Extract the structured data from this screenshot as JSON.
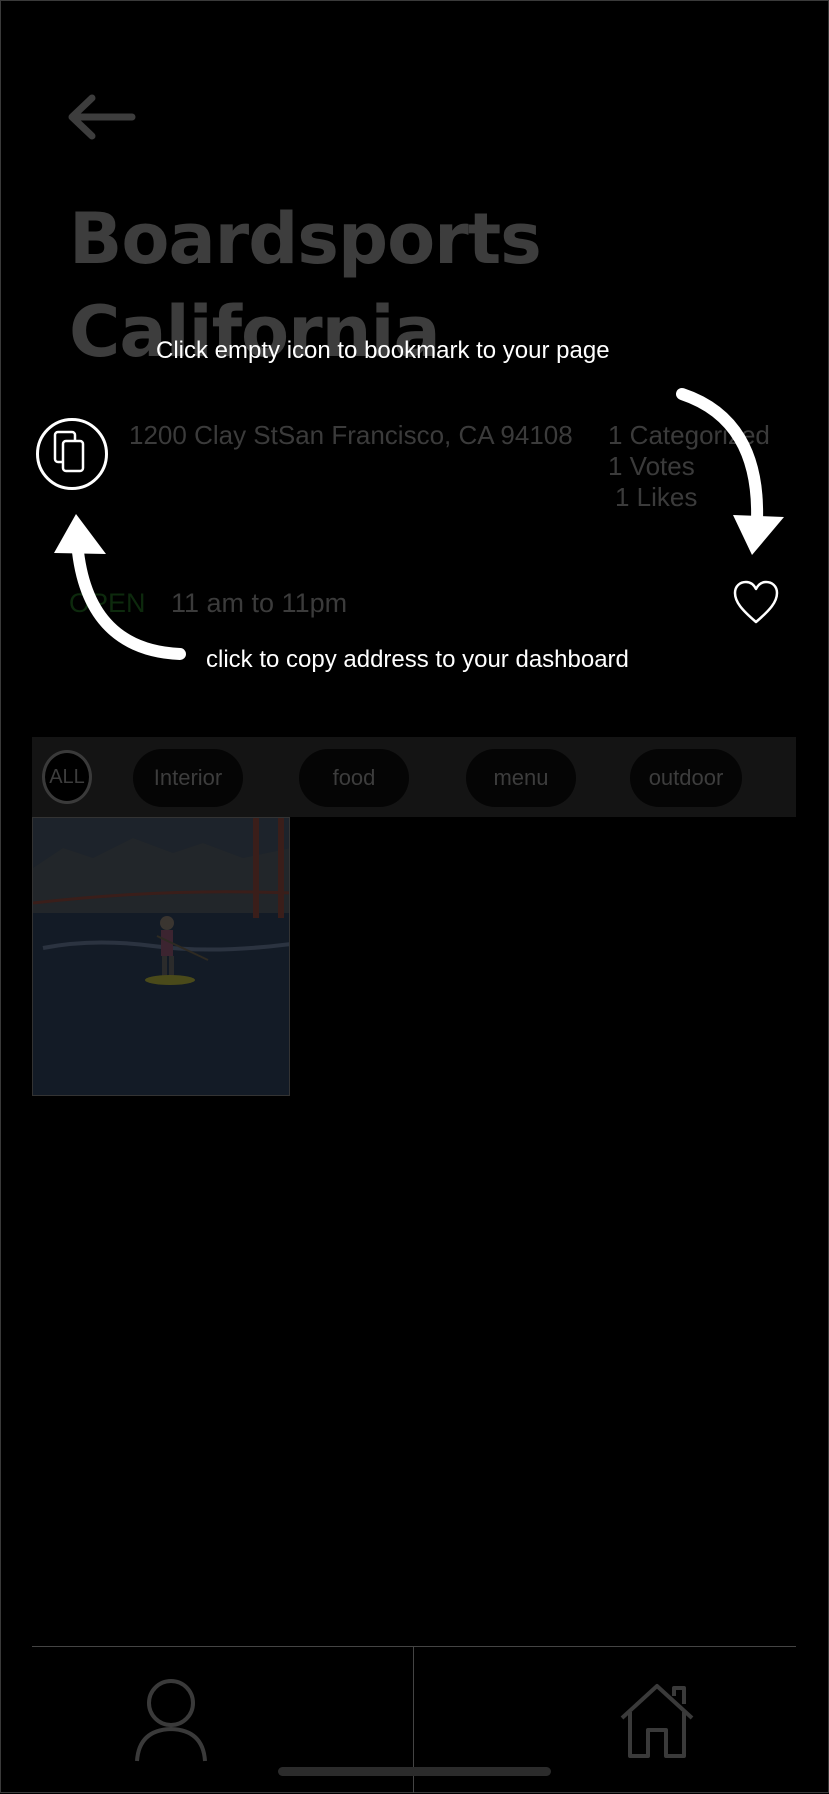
{
  "place": {
    "title": "Boardsports California",
    "address": "1200 Clay StSan Francisco, CA 94108",
    "stats": {
      "categorized": "1 Categorized",
      "votes": "1 Votes",
      "likes": "1 Likes"
    },
    "open_label": "OPEN",
    "hours": "11 am to 11pm"
  },
  "filters": {
    "all": "ALL",
    "chips": [
      "Interior",
      "food",
      "menu",
      "outdoor"
    ]
  },
  "tutorial": {
    "bookmark_tip": "Click empty icon to bookmark to your page",
    "copy_tip": "click to copy address to your dashboard"
  },
  "nav": {
    "left_icon": "profile-icon",
    "right_icon": "home-icon"
  },
  "colors": {
    "background": "#000000",
    "dimmed_text": "#3b3b3b",
    "tip_text": "#ffffff",
    "open_green": "#0d2a0d"
  }
}
